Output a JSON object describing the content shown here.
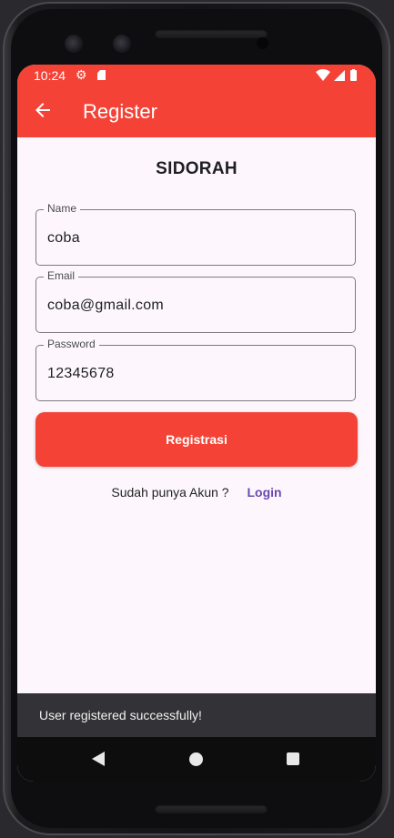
{
  "status_bar": {
    "time": "10:24",
    "icons": [
      "gear-icon",
      "sd-card-icon",
      "wifi-icon",
      "cellular-signal-icon",
      "battery-icon"
    ]
  },
  "app_bar": {
    "title": "Register",
    "back_icon": "arrow-back-icon"
  },
  "form": {
    "brand": "SIDORAH",
    "name": {
      "label": "Name",
      "value": "coba"
    },
    "email": {
      "label": "Email",
      "value": "coba@gmail.com"
    },
    "password": {
      "label": "Password",
      "value": "12345678"
    },
    "submit_label": "Registrasi"
  },
  "login_prompt": {
    "text": "Sudah punya Akun ?",
    "link": "Login"
  },
  "snackbar": {
    "message": "User registered successfully!"
  },
  "nav_bar": {
    "icons": [
      "back-triangle-icon",
      "home-circle-icon",
      "recents-square-icon"
    ]
  },
  "colors": {
    "primary": "#f44336",
    "background": "#fdf7fd",
    "link": "#6a48b0",
    "snackbar": "#333236"
  }
}
